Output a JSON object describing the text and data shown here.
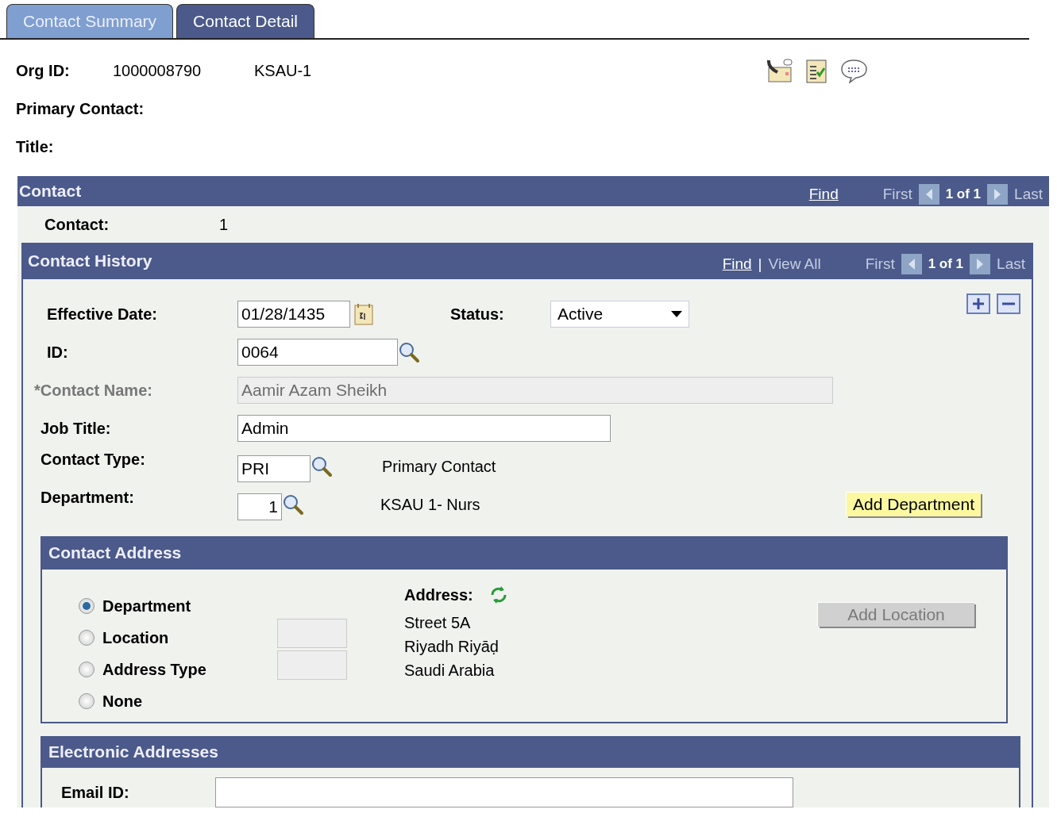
{
  "tabs": [
    {
      "label": "Contact Summary",
      "selected": false
    },
    {
      "label": "Contact Detail",
      "selected": true
    }
  ],
  "header": {
    "org_id_label": "Org ID:",
    "org_id": "1000008790",
    "org_name": "KSAU-1",
    "primary_contact_label": "Primary Contact:",
    "title_label": "Title:"
  },
  "contact": {
    "title": "Contact",
    "nav": {
      "find": "Find",
      "first": "First",
      "counter": "1 of 1",
      "last": "Last"
    },
    "contact_label": "Contact:",
    "contact_value": "1"
  },
  "history": {
    "title": "Contact History",
    "nav": {
      "find": "Find",
      "separator": "|",
      "view_all": "View All",
      "first": "First",
      "counter": "1 of 1",
      "last": "Last"
    },
    "effective_date": {
      "label": "Effective Date:",
      "value": "01/28/1435"
    },
    "status": {
      "label": "Status:",
      "value": "Active"
    },
    "id": {
      "label": "ID:",
      "value": "0064"
    },
    "contact_name": {
      "label": "*Contact Name:",
      "value": "Aamir Azam Sheikh",
      "disabled": true
    },
    "job_title": {
      "label": "Job Title:",
      "value": "Admin"
    },
    "contact_type": {
      "label": "Contact Type:",
      "value": "PRI",
      "description": "Primary Contact"
    },
    "department": {
      "label": "Department:",
      "value": "1",
      "description": "KSAU 1- Nurs"
    },
    "add_department": {
      "label": "Add Department",
      "disabled": false
    }
  },
  "address": {
    "title": "Contact Address",
    "options": [
      {
        "label": "Department",
        "selected": true
      },
      {
        "label": "Location",
        "selected": false
      },
      {
        "label": "Address Type",
        "selected": false
      },
      {
        "label": "None",
        "selected": false
      }
    ],
    "address_label": "Address:",
    "address_lines": [
      "Street 5A",
      "Riyadh Riyāḍ",
      "Saudi Arabia"
    ],
    "add_location": {
      "label": "Add Location",
      "disabled": true
    }
  },
  "electronic": {
    "title": "Electronic Addresses",
    "email_label": "Email ID:"
  }
}
